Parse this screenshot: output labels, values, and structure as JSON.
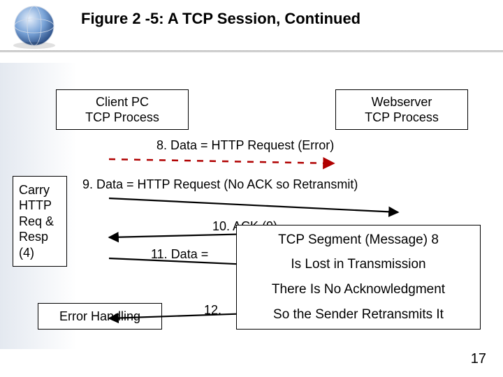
{
  "title": "Figure 2 -5: A TCP Session, Continued",
  "client_box": {
    "line1": "Client PC",
    "line2": "TCP Process"
  },
  "server_box": {
    "line1": "Webserver",
    "line2": "TCP Process"
  },
  "carry_box": {
    "line1": "Carry",
    "line2": "HTTP",
    "line3": "Req &",
    "line4": "Resp",
    "line5": "(4)"
  },
  "errh_box": "Error Handling",
  "msgs": {
    "m8": "8. Data = HTTP Request (Error)",
    "m9": "9. Data = HTTP Request (No ACK so Retransmit)",
    "m10": "10. ACK (9)",
    "m11": "11. Data =",
    "m12": "12."
  },
  "popup": {
    "l1": "TCP Segment (Message) 8",
    "l2": "Is Lost in Transmission",
    "l3": "There Is No Acknowledgment",
    "l4": "So the Sender Retransmits It"
  },
  "page_number": "17"
}
